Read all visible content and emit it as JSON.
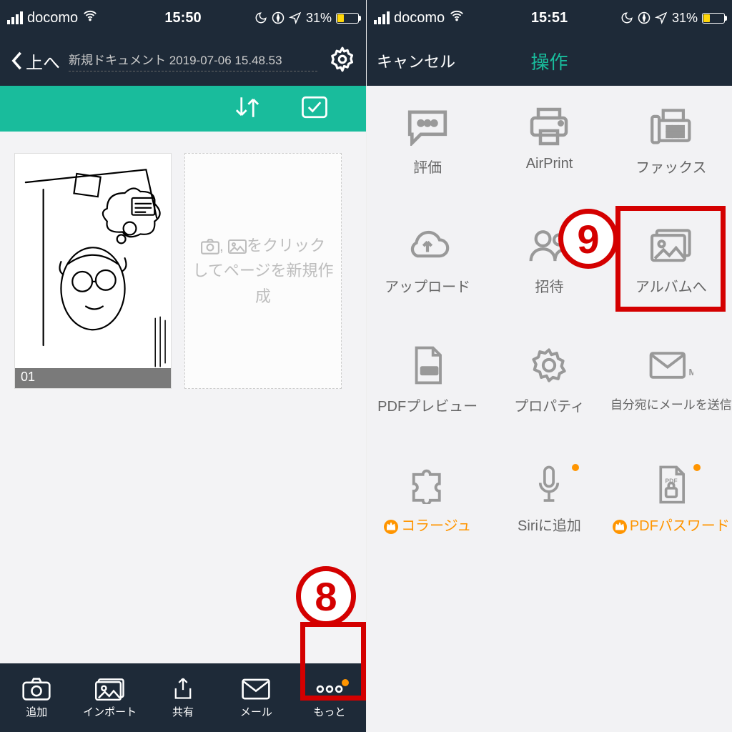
{
  "left": {
    "status": {
      "carrier": "docomo",
      "time": "15:50",
      "battery_pct": "31%"
    },
    "nav": {
      "back_label": "上へ",
      "doc_title": "新規ドキュメント 2019-07-06 15.48.53"
    },
    "thumbnail": {
      "badge": "01"
    },
    "add_page": {
      "line1_prefix": "をクリック",
      "line2": "してページを新規作成"
    },
    "tabs": {
      "add": "追加",
      "import": "インポート",
      "share": "共有",
      "mail": "メール",
      "more": "もっと"
    },
    "annotation": "8"
  },
  "right": {
    "status": {
      "carrier": "docomo",
      "time": "15:51",
      "battery_pct": "31%"
    },
    "nav": {
      "cancel": "キャンセル",
      "title": "操作"
    },
    "actions": {
      "rate": "評価",
      "airprint": "AirPrint",
      "fax": "ファックス",
      "upload": "アップロード",
      "invite": "招待",
      "album": "アルバムへ",
      "pdf_preview": "PDFプレビュー",
      "property": "プロパティ",
      "mail_self": "自分宛にメールを送信",
      "collage": "コラージュ",
      "siri": "Siriに追加",
      "pdf_password": "PDFパスワード"
    },
    "annotation": "9"
  }
}
